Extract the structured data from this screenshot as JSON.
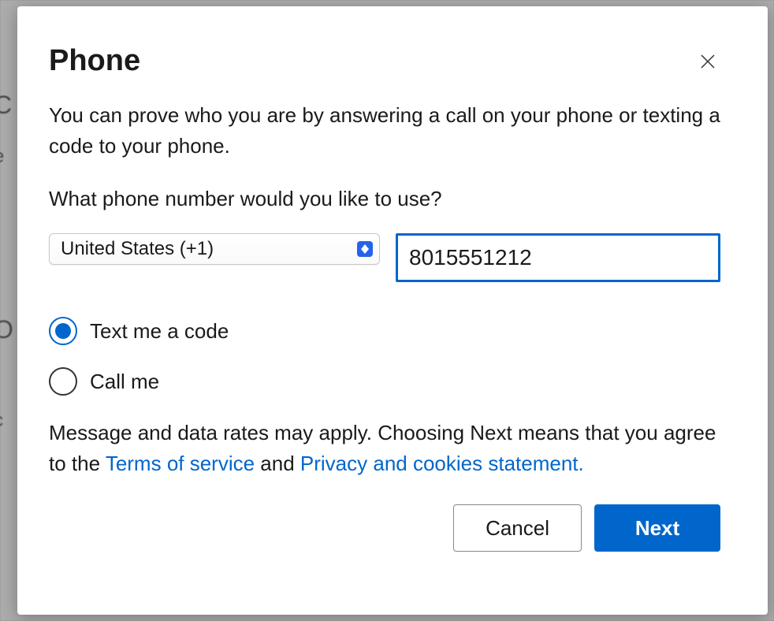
{
  "modal": {
    "title": "Phone",
    "description": "You can prove who you are by answering a call on your phone or texting a code to your phone.",
    "prompt": "What phone number would you like to use?",
    "country_select": {
      "selected": "United States (+1)"
    },
    "phone_input": {
      "value": "8015551212"
    },
    "radio_options": {
      "text_code": "Text me a code",
      "call_me": "Call me",
      "selected": "text_code"
    },
    "disclaimer": {
      "prefix": "Message and data rates may apply. Choosing Next means that you agree to the ",
      "terms_link": "Terms of service",
      "middle": " and ",
      "privacy_link": "Privacy and cookies statement.",
      "suffix": ""
    },
    "buttons": {
      "cancel": "Cancel",
      "next": "Next"
    }
  }
}
